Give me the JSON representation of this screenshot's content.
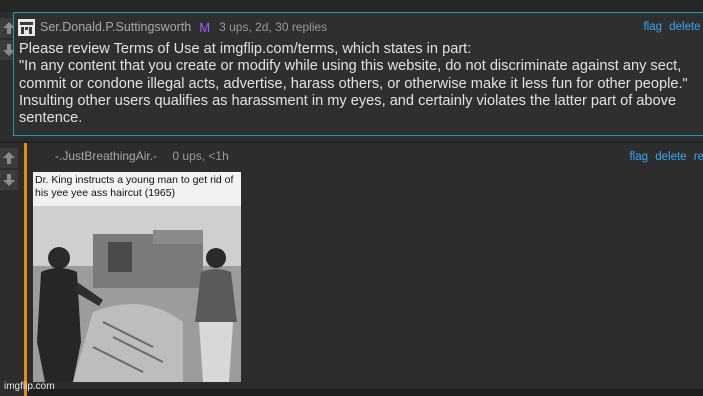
{
  "comment1": {
    "username": "Ser.Donald.P.Suttingsworth",
    "badge": "M",
    "meta": "3 ups, 2d, 30 replies",
    "actions": [
      "flag",
      "delete",
      "re"
    ],
    "lines": [
      "Please review Terms of Use at imgflip.com/terms, which states in part:",
      "\"In any content that you create or modify while using this website, do not discriminate against any sect,",
      "commit or condone illegal acts, advertise, harass others, or otherwise make it less fun for other people.\"",
      "Insulting other users qualifies as harassment in my eyes, and certainly violates the latter part of above",
      "sentence."
    ]
  },
  "comment2": {
    "username": "-.JustBreathingAir.-",
    "meta": "0 ups, <1h",
    "actions": [
      "flag",
      "delete",
      "re"
    ],
    "meme_caption": "Dr. King instructs a young man to get rid of his yee yee ass haircut (1965)",
    "watermark": "imgflip.com"
  },
  "colors": {
    "background": "#2d2d2d",
    "highlight_border": "#1a9bbd",
    "mod_badge": "#a25cff",
    "link": "#35a9f2",
    "thread_bar": "#e88a16"
  },
  "icons": [
    "upvote-arrow-icon",
    "downvote-arrow-icon",
    "user-avatar-icon"
  ]
}
